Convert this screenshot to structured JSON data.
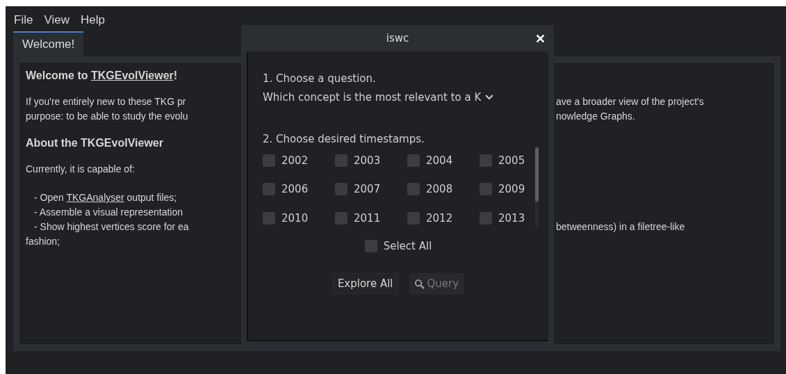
{
  "menu": [
    "File",
    "View",
    "Help"
  ],
  "tabs": [
    {
      "label": "Welcome!",
      "selected": true
    }
  ],
  "content": {
    "heading": "Welcome to ",
    "heading_link": "TKGEvolViewer",
    "heading_end": "!",
    "intro_lines": [
      {
        "left": "If you're entirely new to these TKG pr",
        "right": "ave a broader view of the project's"
      },
      {
        "left": "purpose: to be able to study the evolu",
        "right": "nowledge Graphs."
      }
    ],
    "section": "About the TKGEvolViewer",
    "capable": "Currently, it is capable of:",
    "items": [
      {
        "prefix": "- Open ",
        "link": "TKGAnalyser",
        "suffix": " output files;"
      },
      {
        "prefix": "- Assemble a visual representation"
      },
      {
        "prefix": "- Show highest vertices score for ea",
        "right": "betweenness) in a filetree-like"
      }
    ],
    "tail": "fashion;"
  },
  "dialog": {
    "title": "iswc",
    "close": "✕",
    "step1": "1. Choose a question.",
    "question": "Which concept is the most relevant to a K",
    "step2": "2. Choose desired timestamps.",
    "years": [
      {
        "label": "2002",
        "checked": false
      },
      {
        "label": "2003",
        "checked": false
      },
      {
        "label": "2004",
        "checked": false
      },
      {
        "label": "2005",
        "checked": false
      },
      {
        "label": "2006",
        "checked": false
      },
      {
        "label": "2007",
        "checked": false
      },
      {
        "label": "2008",
        "checked": false
      },
      {
        "label": "2009",
        "checked": false
      },
      {
        "label": "2010",
        "checked": false
      },
      {
        "label": "2011",
        "checked": false
      },
      {
        "label": "2012",
        "checked": false
      },
      {
        "label": "2013",
        "checked": false
      }
    ],
    "select_all": {
      "label": "Select All",
      "checked": false
    },
    "explore": {
      "label": "Explore All",
      "disabled": false
    },
    "query": {
      "label": "Query",
      "disabled": true
    }
  }
}
